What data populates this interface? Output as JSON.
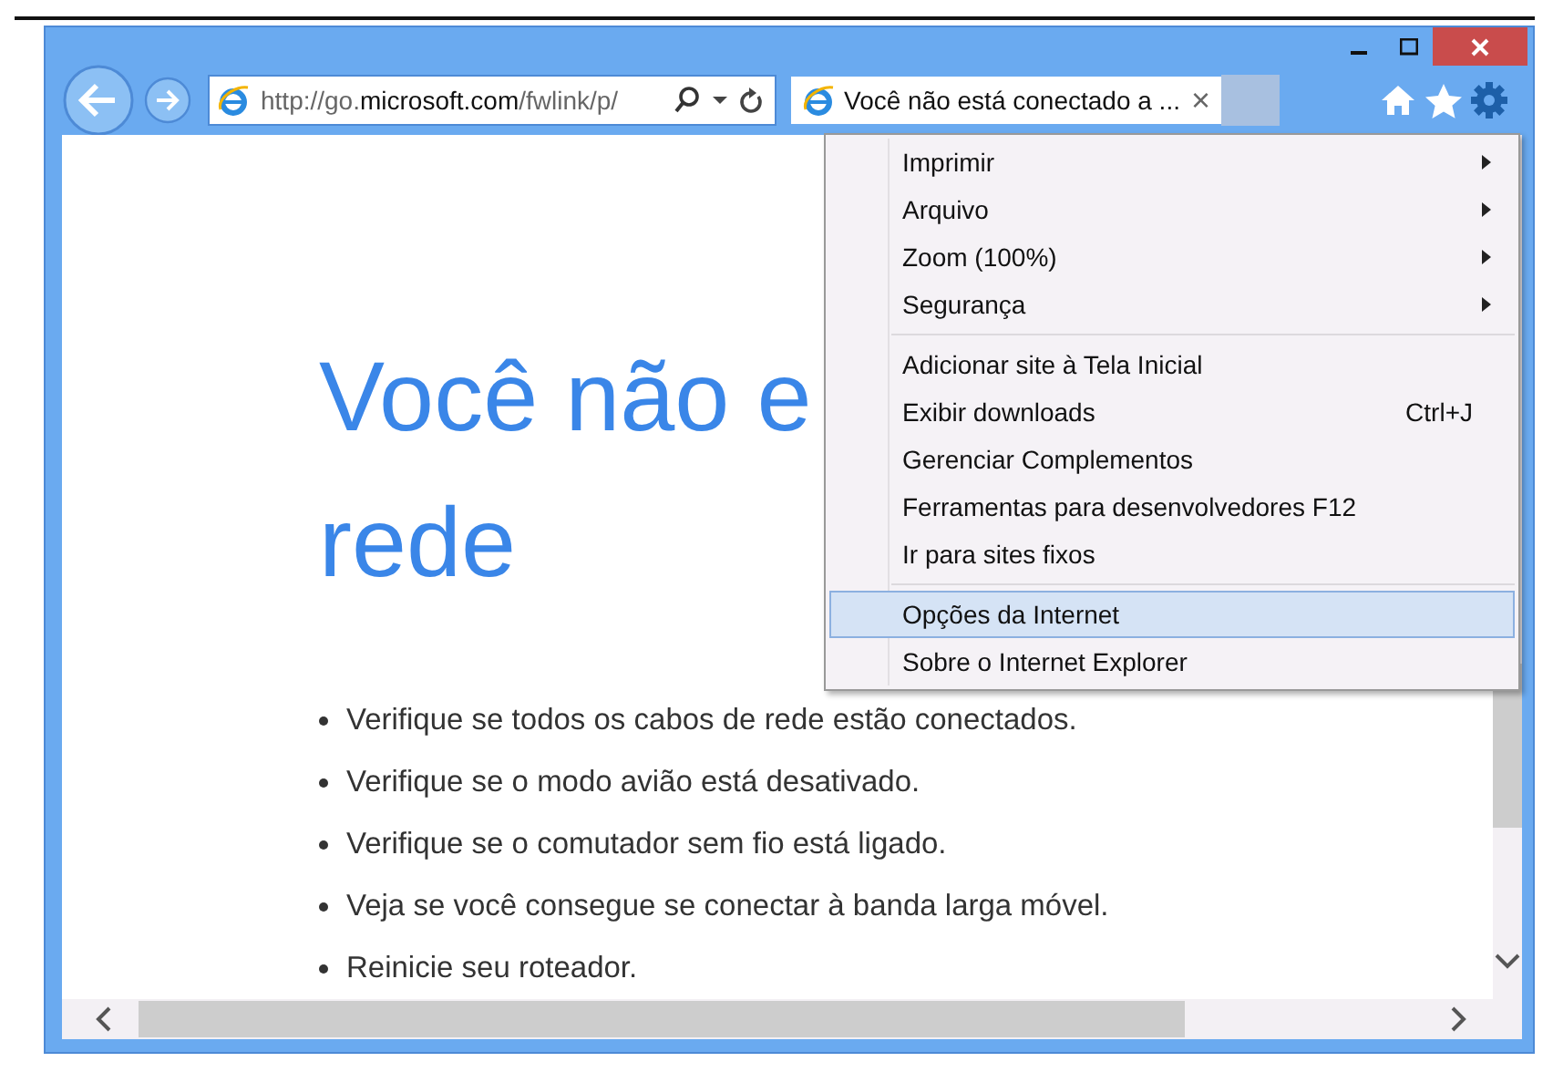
{
  "address_bar": {
    "url": "http://go.**microsoft.com**/fwlink/p/"
  },
  "tabs": [
    {
      "title": "Você não está conectado a ...",
      "close": "×",
      "selected": true
    }
  ],
  "page": {
    "heading_lines": [
      "Você não e",
      "rede"
    ],
    "bullets": [
      "Verifique se todos os cabos de rede estão conectados.",
      "Verifique se o modo avião está desativado.",
      "Verifique se o comutador sem fio está ligado.",
      "Veja se você consegue se conectar à banda larga móvel.",
      "Reinicie seu roteador."
    ]
  },
  "tools_menu": {
    "groups": [
      [
        {
          "label": "Imprimir",
          "submenu": true,
          "selected": false
        },
        {
          "label": "Arquivo",
          "submenu": true,
          "selected": false
        },
        {
          "label": "Zoom (100%)",
          "submenu": true,
          "selected": false
        },
        {
          "label": "Segurança",
          "submenu": true,
          "selected": false
        }
      ],
      [
        {
          "label": "Adicionar site à Tela Inicial",
          "submenu": false,
          "selected": false
        },
        {
          "label": "Exibir downloads",
          "shortcut": "Ctrl+J",
          "submenu": false,
          "selected": false
        },
        {
          "label": "Gerenciar Complementos",
          "submenu": false,
          "selected": false
        },
        {
          "label": "Ferramentas para desenvolvedores F12",
          "submenu": false,
          "selected": false
        },
        {
          "label": "Ir para sites fixos",
          "submenu": false,
          "selected": false
        }
      ],
      [
        {
          "label": "Opções da Internet",
          "submenu": false,
          "selected": true
        },
        {
          "label": "Sobre o Internet Explorer",
          "submenu": false,
          "selected": false
        }
      ]
    ]
  }
}
